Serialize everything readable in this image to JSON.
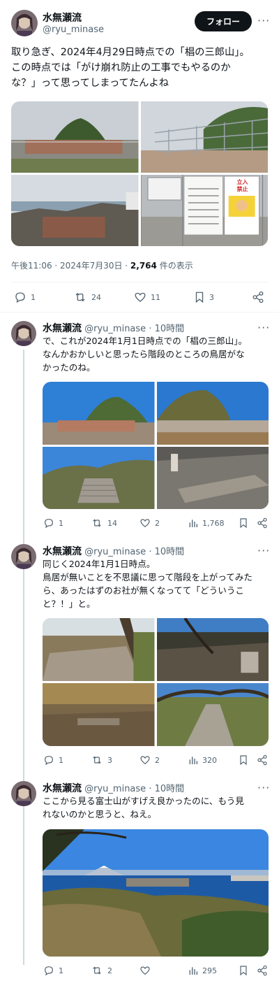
{
  "main_tweet": {
    "author_name": "水無瀬流",
    "author_handle": "@ryu_minase",
    "follow_label": "フォロー",
    "more_label": "···",
    "text": "取り急ぎ、2024年4月29日時点での「椙の三郎山」。\nこの時点では「がけ崩れ防止の工事でもやるのか\nな？」って思ってしまってたんよね",
    "timestamp": "午後11:06 · 2024年7月30日 · ",
    "views_count": "2,764",
    "views_suffix": " 件の表示",
    "actions": {
      "reply": "1",
      "retweet": "24",
      "like": "11",
      "bookmark": "3"
    },
    "sign_text": {
      "line1": "立入",
      "line2": "禁止"
    }
  },
  "replies": [
    {
      "author_name": "水無瀬流",
      "author_handle": "@ryu_minase",
      "time": "10時間",
      "text": "で、これが2024年1月1日時点での「椙の三郎山」。\nなんかおかしいと思ったら階段のところの鳥居がな\nかったのね。",
      "actions": {
        "reply": "1",
        "retweet": "14",
        "like": "2",
        "views": "1,768"
      }
    },
    {
      "author_name": "水無瀬流",
      "author_handle": "@ryu_minase",
      "time": "10時間",
      "text": "同じく2024年1月1日時点。\n鳥居が無いことを不思議に思って階段を上がってみた\nら、あったはずのお社が無くなってて「どういうこ\nと？！」と。",
      "actions": {
        "reply": "1",
        "retweet": "3",
        "like": "2",
        "views": "320"
      }
    },
    {
      "author_name": "水無瀬流",
      "author_handle": "@ryu_minase",
      "time": "10時間",
      "text": "ここから見る富士山がすげえ良かったのに、もう見\nれないのかと思うと、ねえ。",
      "actions": {
        "reply": "1",
        "retweet": "2",
        "like": "",
        "views": "295"
      }
    }
  ],
  "colors": {
    "text": "#0f1419",
    "secondary": "#536471",
    "divider": "#eff3f4",
    "thread": "#cfd9de"
  }
}
